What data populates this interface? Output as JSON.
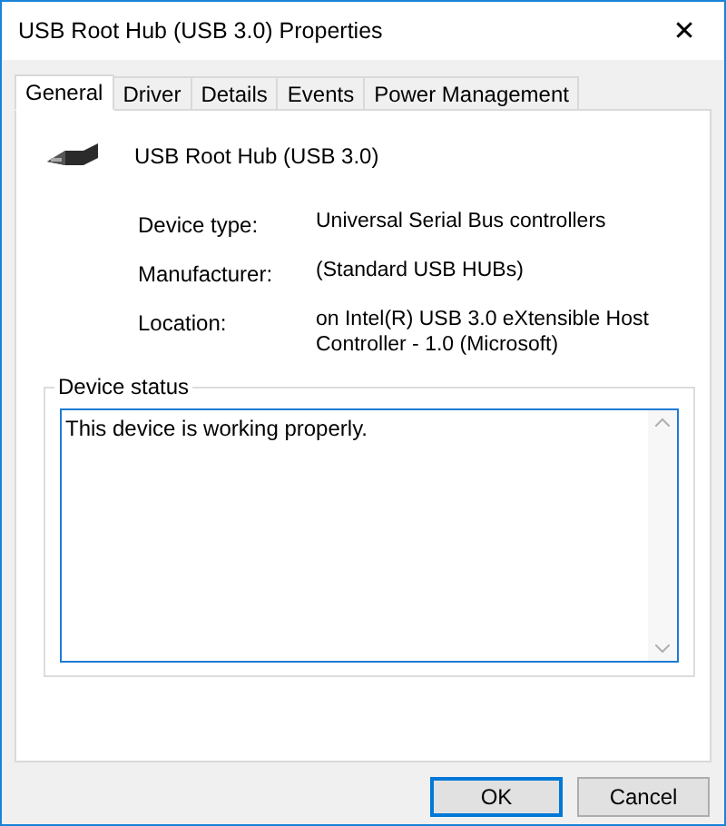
{
  "window": {
    "title": "USB Root Hub (USB 3.0) Properties",
    "close": "✕"
  },
  "tabs": [
    {
      "label": "General",
      "selected": true
    },
    {
      "label": "Driver",
      "selected": false
    },
    {
      "label": "Details",
      "selected": false
    },
    {
      "label": "Events",
      "selected": false
    },
    {
      "label": "Power Management",
      "selected": false
    }
  ],
  "device": {
    "name": "USB Root Hub (USB 3.0)"
  },
  "properties": [
    {
      "label": "Device type:",
      "value": "Universal Serial Bus controllers"
    },
    {
      "label": "Manufacturer:",
      "value": "(Standard USB HUBs)"
    },
    {
      "label": "Location:",
      "value": "on Intel(R) USB 3.0 eXtensible Host Controller - 1.0 (Microsoft)"
    }
  ],
  "device_status": {
    "title": "Device status",
    "value": "This device is working properly."
  },
  "buttons": [
    {
      "label": "OK",
      "default": true
    },
    {
      "label": "Cancel",
      "default": false
    }
  ]
}
